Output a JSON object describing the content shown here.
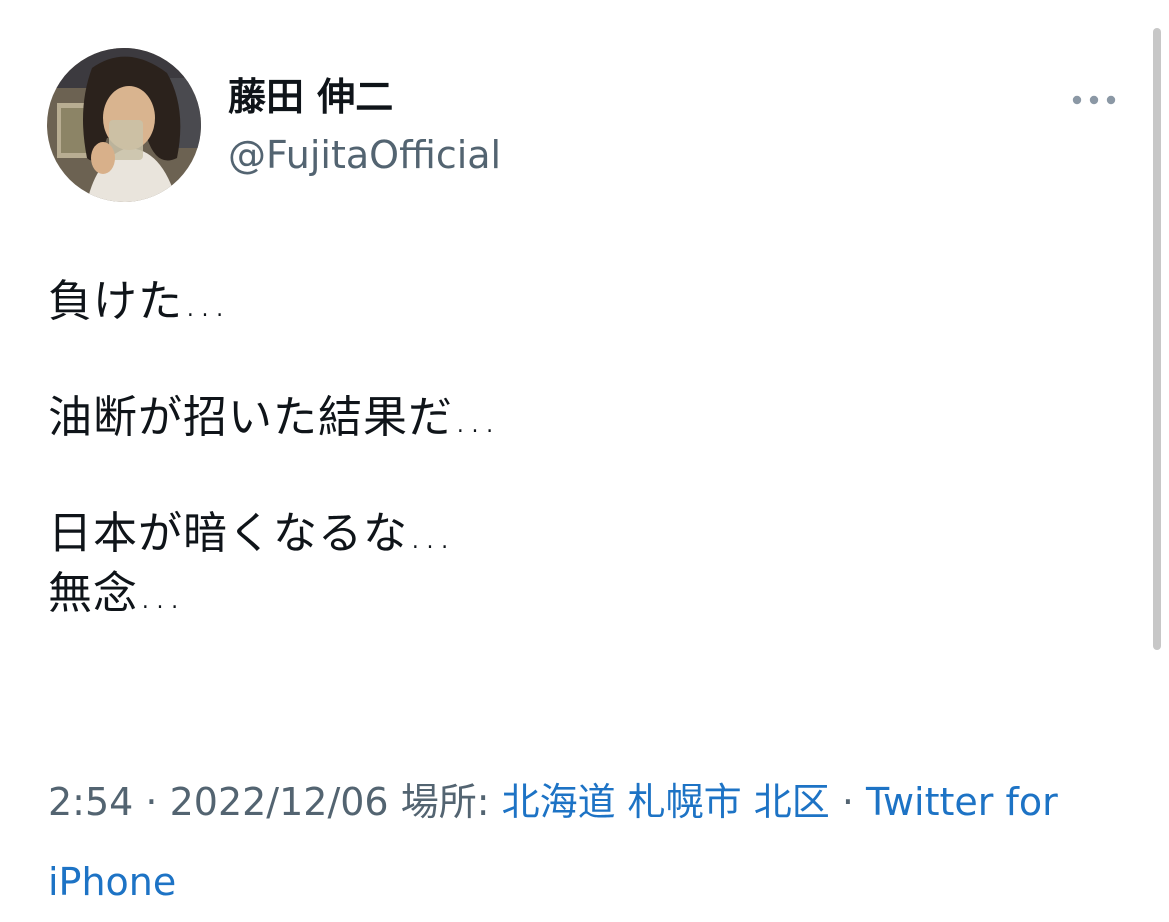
{
  "tweet": {
    "author": {
      "display_name": "藤田 伸二",
      "handle": "@FujitaOfficial"
    },
    "menu_icon": "more-horizontal-icon",
    "lines": [
      "負けた…",
      "油断が招いた結果だ…",
      "日本が暗くなるな…",
      "無念…"
    ],
    "meta": {
      "time": "2:54",
      "separator": " · ",
      "date": "2022/12/06",
      "location_label": " 場所: ",
      "location": "北海道 札幌市 北区",
      "source": "Twitter for iPhone"
    }
  },
  "colors": {
    "text": "#0f1419",
    "secondary": "#536471",
    "link": "#1d73c5",
    "background": "#ffffff"
  }
}
